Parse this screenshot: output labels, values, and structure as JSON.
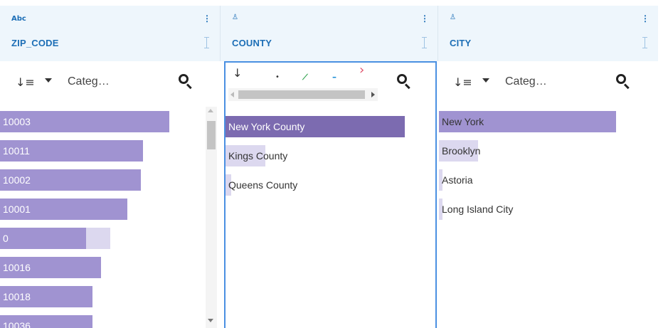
{
  "columns": {
    "zip": {
      "type_badge": "Abc",
      "name": "ZIP_CODE",
      "sort_label": "Categ…",
      "items": [
        {
          "label": "10003",
          "share": 0.77,
          "extra": 0
        },
        {
          "label": "10011",
          "share": 0.65,
          "extra": 0
        },
        {
          "label": "10002",
          "share": 0.64,
          "extra": 0
        },
        {
          "label": "10001",
          "share": 0.58,
          "extra": 0
        },
        {
          "label": "0",
          "share": 0.39,
          "extra": 0.11
        },
        {
          "label": "10016",
          "share": 0.46,
          "extra": 0
        },
        {
          "label": "10018",
          "share": 0.42,
          "extra": 0
        },
        {
          "label": "10036",
          "share": 0.42,
          "extra": 0
        }
      ]
    },
    "county": {
      "type_badge": "♙",
      "name": "COUNTY",
      "items": [
        {
          "label": "New York County",
          "share": 0.9,
          "selected": true
        },
        {
          "label": "Kings County",
          "share": 0.2,
          "selected": false
        },
        {
          "label": "Queens County",
          "share": 0.03,
          "selected": false
        }
      ]
    },
    "city": {
      "type_badge": "♙",
      "name": "CITY",
      "sort_label": "Categ…",
      "items": [
        {
          "label": "New York",
          "share": 0.81
        },
        {
          "label": "Brooklyn",
          "share": 0.18
        },
        {
          "label": "Astoria",
          "share": 0.015
        },
        {
          "label": "Long Island City",
          "share": 0.015
        }
      ]
    }
  },
  "colors": {
    "header_bg": "#eef6fc",
    "accent": "#1c6eb6",
    "bar": "#a093d1",
    "bar_selected": "#7c6bb0",
    "bar_light": "#dcd8ef",
    "panel_border": "#4a90e2"
  }
}
